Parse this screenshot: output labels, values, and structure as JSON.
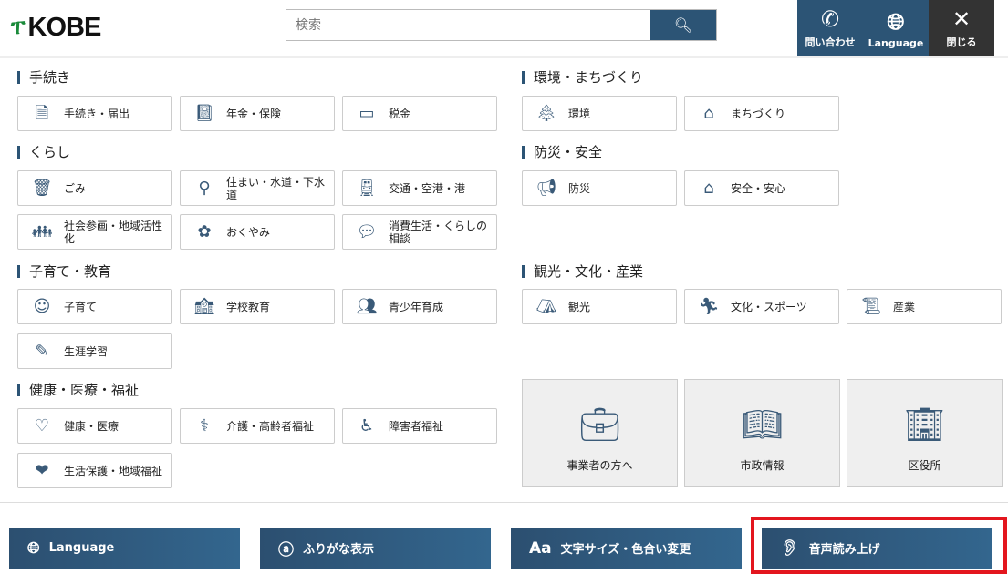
{
  "header": {
    "logo": "KOBE",
    "search_placeholder": "検索",
    "nav": [
      {
        "label": "問い合わせ",
        "icon": "phone-icon"
      },
      {
        "label": "Language",
        "icon": "globe-icon"
      },
      {
        "label": "閉じる",
        "icon": "close-icon"
      }
    ]
  },
  "sections": [
    {
      "title": "手続き",
      "items": [
        {
          "label": "手続き・届出",
          "icon": "document-icon"
        },
        {
          "label": "年金・保険",
          "icon": "notebook-icon"
        },
        {
          "label": "税金",
          "icon": "wallet-icon"
        }
      ]
    },
    {
      "title": "くらし",
      "items": [
        {
          "label": "ごみ",
          "icon": "trash-icon"
        },
        {
          "label": "住まい・水道・下水道",
          "icon": "faucet-icon"
        },
        {
          "label": "交通・空港・港",
          "icon": "train-icon"
        },
        {
          "label": "社会参画・地域活性化",
          "icon": "people-icon"
        },
        {
          "label": "おくやみ",
          "icon": "flower-icon"
        },
        {
          "label": "消費生活・くらしの相談",
          "icon": "chat-icon"
        }
      ]
    },
    {
      "title": "子育て・教育",
      "items": [
        {
          "label": "子育て",
          "icon": "baby-icon"
        },
        {
          "label": "学校教育",
          "icon": "school-icon"
        },
        {
          "label": "青少年育成",
          "icon": "youth-icon"
        },
        {
          "label": "生涯学習",
          "icon": "study-icon"
        }
      ]
    },
    {
      "title": "健康・医療・福祉",
      "items": [
        {
          "label": "健康・医療",
          "icon": "heartbeat-icon"
        },
        {
          "label": "介護・高齢者福祉",
          "icon": "elderly-icon"
        },
        {
          "label": "障害者福祉",
          "icon": "wheelchair-icon"
        },
        {
          "label": "生活保護・地域福祉",
          "icon": "hand-heart-icon"
        }
      ]
    },
    {
      "title": "環境・まちづくり",
      "items": [
        {
          "label": "環境",
          "icon": "trees-icon"
        },
        {
          "label": "まちづくり",
          "icon": "house-icon"
        }
      ]
    },
    {
      "title": "防災・安全",
      "items": [
        {
          "label": "防災",
          "icon": "megaphone-icon"
        },
        {
          "label": "安全・安心",
          "icon": "safe-house-icon"
        }
      ]
    },
    {
      "title": "観光・文化・産業",
      "items": [
        {
          "label": "観光",
          "icon": "tent-icon"
        },
        {
          "label": "文化・スポーツ",
          "icon": "runner-icon"
        },
        {
          "label": "産業",
          "icon": "scroll-icon"
        }
      ]
    }
  ],
  "tiles": [
    {
      "label": "事業者の方へ",
      "icon": "briefcase-icon"
    },
    {
      "label": "市政情報",
      "icon": "book-icon"
    },
    {
      "label": "区役所",
      "icon": "building-icon"
    }
  ],
  "bottom": [
    {
      "label": "Language",
      "icon": "globe-icon"
    },
    {
      "label": "ふりがな表示",
      "icon": "furigana-icon"
    },
    {
      "label": "文字サイズ・色合い変更",
      "icon": "text-size-icon"
    },
    {
      "label": "音声読み上げ",
      "icon": "ear-icon"
    }
  ]
}
